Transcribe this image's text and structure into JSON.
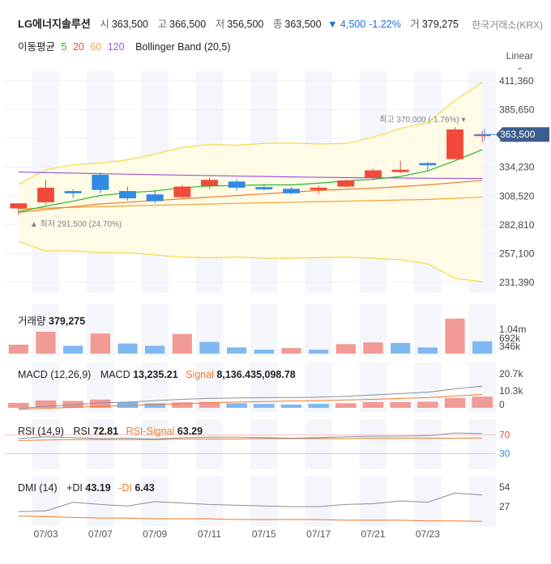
{
  "header": {
    "name": "LG에너지솔루션",
    "open_label": "시",
    "open": "363,500",
    "high_label": "고",
    "high": "366,500",
    "low_label": "저",
    "low": "356,500",
    "close_label": "종",
    "close": "363,500",
    "change": "▼ 4,500",
    "change_pct": "-1.22%",
    "volume_label": "거",
    "volume": "379,275",
    "exchange": "한국거래소(KRX)"
  },
  "indicators": {
    "ma_label": "이동평균",
    "ma5": "5",
    "ma20": "20",
    "ma60": "60",
    "ma120": "120",
    "bb_label": "Bollinger Band (20,5)",
    "scale_label": "Linear",
    "scale_chevron": "⌄"
  },
  "colors": {
    "up": "#f04a3a",
    "down": "#2f8be6",
    "ma5": "#2bb52b",
    "ma20": "#f07a2a",
    "ma60": "#f2a23a",
    "ma120": "#9b59d6",
    "bb": "#f5d94a",
    "price_tag": "#3d5d8c"
  },
  "price_tag": "363,500",
  "high_marker": "최고 370,000 (-1.76%)",
  "low_marker": "최저 291,500 (24.70%)",
  "volume_panel": {
    "label": "거래량",
    "value": "379,275",
    "ticks": [
      "1.04m",
      "692k",
      "346k"
    ]
  },
  "macd_panel": {
    "label": "MACD (12,26,9)",
    "macd_label": "MACD",
    "macd_value": "13,235.21",
    "signal_label": "Signal",
    "signal_value": "8,136.435,098.78",
    "ticks": [
      "20.7k",
      "10.3k",
      "0"
    ]
  },
  "rsi_panel": {
    "label": "RSI (14,9)",
    "rsi_label": "RSI",
    "rsi_value": "72.81",
    "signal_label": "RSI-Signal",
    "signal_value": "63.29",
    "ticks": [
      "70",
      "30"
    ]
  },
  "dmi_panel": {
    "label": "DMI (14)",
    "pdi_label": "+DI",
    "pdi_value": "43.19",
    "mdi_label": "-DI",
    "mdi_value": "6.43",
    "ticks": [
      "54",
      "27"
    ]
  },
  "chart_data": {
    "type": "candlestick",
    "y_ticks": [
      411360,
      385650,
      360000,
      334230,
      308520,
      282810,
      257100,
      231390
    ],
    "ylim": [
      231390,
      411360
    ],
    "x_labels": [
      "07/03",
      "07/07",
      "07/09",
      "07/11",
      "07/15",
      "07/17",
      "07/21",
      "07/23"
    ],
    "candles": [
      {
        "o": 297500,
        "h": 302000,
        "l": 291500,
        "c": 302000
      },
      {
        "o": 303000,
        "h": 323000,
        "l": 301000,
        "c": 316000
      },
      {
        "o": 313000,
        "h": 314500,
        "l": 307000,
        "c": 311000
      },
      {
        "o": 327500,
        "h": 329500,
        "l": 311000,
        "c": 314000
      },
      {
        "o": 313000,
        "h": 317000,
        "l": 304500,
        "c": 306500
      },
      {
        "o": 310000,
        "h": 314000,
        "l": 302000,
        "c": 304000
      },
      {
        "o": 307500,
        "h": 318500,
        "l": 306000,
        "c": 317000
      },
      {
        "o": 317500,
        "h": 325000,
        "l": 315000,
        "c": 323000
      },
      {
        "o": 321500,
        "h": 323500,
        "l": 313500,
        "c": 316000
      },
      {
        "o": 316500,
        "h": 319000,
        "l": 313500,
        "c": 314500
      },
      {
        "o": 315000,
        "h": 316500,
        "l": 310000,
        "c": 311000
      },
      {
        "o": 314000,
        "h": 318000,
        "l": 310500,
        "c": 316000
      },
      {
        "o": 317000,
        "h": 323000,
        "l": 316000,
        "c": 322500
      },
      {
        "o": 325000,
        "h": 333000,
        "l": 322500,
        "c": 331500
      },
      {
        "o": 330000,
        "h": 340000,
        "l": 329000,
        "c": 332000
      },
      {
        "o": 338000,
        "h": 339000,
        "l": 331000,
        "c": 336000
      },
      {
        "o": 341500,
        "h": 370000,
        "l": 341500,
        "c": 368000
      },
      {
        "o": 363500,
        "h": 366500,
        "l": 356500,
        "c": 363500
      }
    ],
    "ma5": [
      294500,
      299500,
      304000,
      309000,
      311500,
      313000,
      316000,
      317500,
      318000,
      318500,
      318500,
      320000,
      322000,
      323500,
      326000,
      331000,
      340000,
      350000
    ],
    "ma20": [
      294000,
      296500,
      299000,
      301500,
      303000,
      304500,
      306000,
      307500,
      309000,
      310500,
      312000,
      313500,
      314500,
      315500,
      317000,
      318500,
      320500,
      322500
    ],
    "ma60": [
      297000,
      297800,
      298500,
      299000,
      299700,
      300300,
      300800,
      301400,
      302000,
      302500,
      303000,
      303500,
      304000,
      304500,
      305000,
      305500,
      306500,
      307500
    ],
    "ma120": [
      330000,
      329500,
      329000,
      328500,
      328000,
      327600,
      327200,
      326800,
      326400,
      326000,
      325600,
      325300,
      325000,
      324800,
      324600,
      324400,
      324300,
      324200
    ],
    "bb_upper": [
      319000,
      332000,
      336500,
      338000,
      341000,
      346000,
      352000,
      354500,
      354000,
      355500,
      356000,
      355000,
      355500,
      361000,
      369000,
      374000,
      394000,
      410000
    ],
    "bb_lower": [
      268000,
      259500,
      259500,
      258000,
      258000,
      256000,
      254000,
      253500,
      254000,
      253000,
      253000,
      253500,
      254000,
      253000,
      251500,
      248000,
      235000,
      232000
    ],
    "volume": [
      {
        "v": 0.32,
        "up": true
      },
      {
        "v": 0.78,
        "up": true
      },
      {
        "v": 0.28,
        "up": false
      },
      {
        "v": 0.72,
        "up": true
      },
      {
        "v": 0.36,
        "up": false
      },
      {
        "v": 0.28,
        "up": false
      },
      {
        "v": 0.7,
        "up": true
      },
      {
        "v": 0.42,
        "up": false
      },
      {
        "v": 0.22,
        "up": false
      },
      {
        "v": 0.14,
        "up": false
      },
      {
        "v": 0.2,
        "up": true
      },
      {
        "v": 0.14,
        "up": false
      },
      {
        "v": 0.34,
        "up": true
      },
      {
        "v": 0.4,
        "up": true
      },
      {
        "v": 0.38,
        "up": false
      },
      {
        "v": 0.22,
        "up": false
      },
      {
        "v": 1.25,
        "up": true
      },
      {
        "v": 0.44,
        "up": false
      }
    ],
    "macd_hist": [
      {
        "v": 3000,
        "up": true
      },
      {
        "v": 4500,
        "up": true
      },
      {
        "v": 4200,
        "up": true
      },
      {
        "v": 5000,
        "up": true
      },
      {
        "v": 3500,
        "up": false
      },
      {
        "v": 2700,
        "up": false
      },
      {
        "v": 3300,
        "up": true
      },
      {
        "v": 3500,
        "up": true
      },
      {
        "v": 2800,
        "up": false
      },
      {
        "v": 2400,
        "up": false
      },
      {
        "v": 2000,
        "up": false
      },
      {
        "v": 2400,
        "up": false
      },
      {
        "v": 2800,
        "up": true
      },
      {
        "v": 3500,
        "up": true
      },
      {
        "v": 3500,
        "up": true
      },
      {
        "v": 3700,
        "up": true
      },
      {
        "v": 6000,
        "up": true
      },
      {
        "v": 6800,
        "up": true
      }
    ],
    "macd_line": [
      -500,
      1000,
      1800,
      3000,
      3500,
      4400,
      5200,
      5800,
      6000,
      6200,
      6300,
      6500,
      7000,
      7800,
      8700,
      9500,
      11500,
      13235
    ],
    "signal_line": [
      -1000,
      -300,
      300,
      900,
      1400,
      2000,
      2600,
      3100,
      3500,
      3800,
      4100,
      4400,
      4800,
      5200,
      5700,
      6200,
      7200,
      8136
    ],
    "rsi": [
      62,
      66,
      64,
      62,
      63,
      61,
      64,
      65,
      65,
      64,
      63,
      64,
      66,
      67,
      67,
      68,
      74,
      72.81
    ],
    "rsi_signal": [
      58,
      59,
      60,
      60,
      60,
      60,
      61,
      61,
      61,
      62,
      62,
      62,
      62,
      63,
      63,
      63,
      63,
      63.29
    ],
    "pdi": [
      20,
      21,
      33,
      30,
      28,
      34,
      32,
      30,
      29,
      28,
      27,
      27,
      30,
      31,
      35,
      33,
      46,
      43.19
    ],
    "mdi": [
      14,
      13,
      12,
      11,
      11,
      10,
      10,
      10,
      9,
      9,
      9,
      9,
      8,
      8,
      8,
      7,
      7,
      6.43
    ],
    "dmi_ylim": [
      0,
      70
    ]
  }
}
